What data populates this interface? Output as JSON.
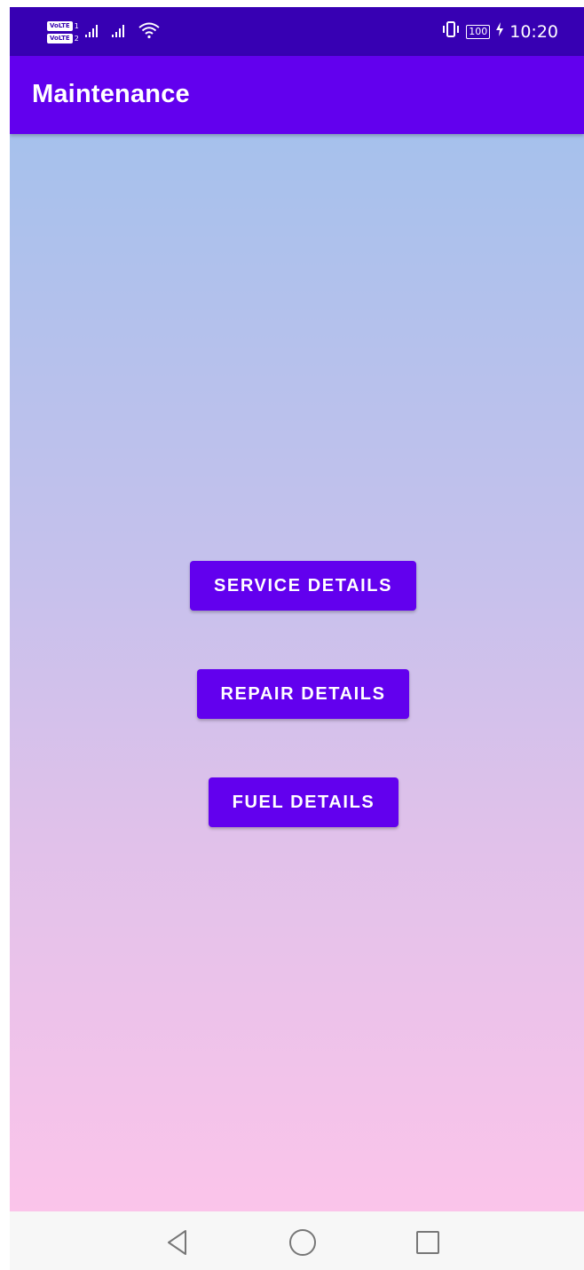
{
  "status_bar": {
    "volte_label_1": "VoLTE",
    "sim_1": "1",
    "volte_label_2": "VoLTE",
    "sim_2": "2",
    "battery_level": "100",
    "time": "10:20",
    "icons": [
      "signal-icon",
      "signal-icon",
      "wifi-icon",
      "vibrate-icon",
      "battery-icon",
      "charging-icon"
    ]
  },
  "app_bar": {
    "title": "Maintenance"
  },
  "buttons": {
    "service": "SERVICE DETAILS",
    "repair": "REPAIR DETAILS",
    "fuel": "FUEL DETAILS"
  },
  "nav_bar": {
    "icons": [
      "back-icon",
      "home-icon",
      "recents-icon"
    ]
  },
  "colors": {
    "status_bar": "#3700b3",
    "app_bar": "#6200ee",
    "button": "#6200ee",
    "gradient_top": "#a6c1ec",
    "gradient_bottom": "#fbc4ea",
    "nav_bar": "#f7f7f7"
  }
}
